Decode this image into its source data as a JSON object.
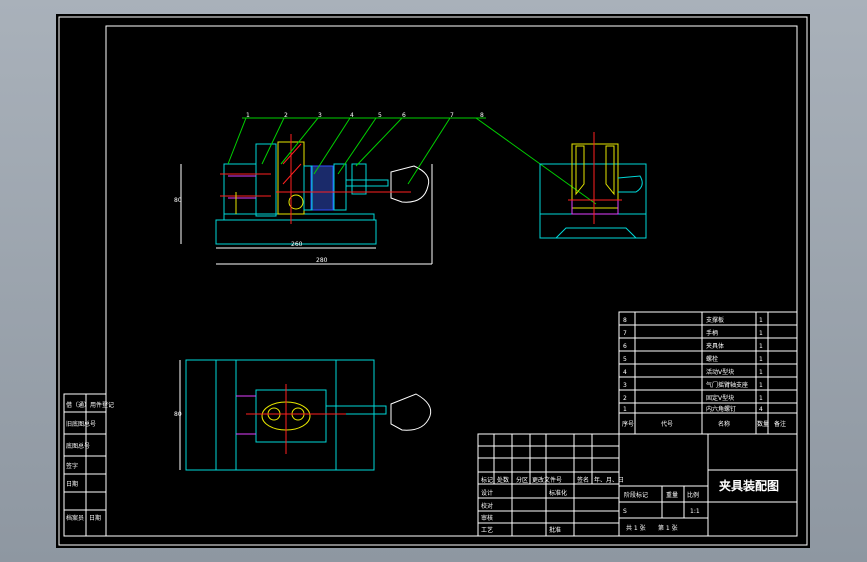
{
  "drawing_title": "夹具装配图",
  "balloons": [
    "1",
    "2",
    "3",
    "4",
    "5",
    "6",
    "7",
    "8"
  ],
  "dimensions": {
    "front_width": "260",
    "front_total": "280",
    "height_left": "80",
    "plan_height": "80"
  },
  "bom": {
    "rows": [
      {
        "no": "8",
        "name": "支撑板",
        "qty": "1"
      },
      {
        "no": "7",
        "name": "手柄",
        "qty": "1"
      },
      {
        "no": "6",
        "name": "夹具体",
        "qty": "1"
      },
      {
        "no": "5",
        "name": "螺栓",
        "qty": "1"
      },
      {
        "no": "4",
        "name": "活动V型块",
        "qty": "1"
      },
      {
        "no": "3",
        "name": "气门摇臂轴支座",
        "qty": "1"
      },
      {
        "no": "2",
        "name": "固定V型块",
        "qty": "1"
      },
      {
        "no": "1",
        "name": "内六角螺钉",
        "qty": "4"
      }
    ],
    "header": {
      "no": "序号",
      "code": "代号",
      "name": "名称",
      "qty": "数量",
      "note": "备注"
    }
  },
  "title_block": {
    "mark": "标记",
    "count": "处数",
    "zone": "分区",
    "doc": "更改文件号",
    "sign": "签名",
    "date": "年、月、日",
    "design": "设计",
    "std": "标准化",
    "check": "校对",
    "review": "审核",
    "process": "工艺",
    "approve": "批准",
    "stage": "阶段标记",
    "weight": "重量",
    "ratio": "比例",
    "scale": "1:1",
    "stage_value": "S",
    "sheets": "共 1 张",
    "sheet_no": "第 1 张"
  },
  "left_strip": [
    "借（通）用件登记",
    "旧底图总号",
    "底图总号",
    "签字",
    "日期",
    "档案员",
    "日期"
  ]
}
